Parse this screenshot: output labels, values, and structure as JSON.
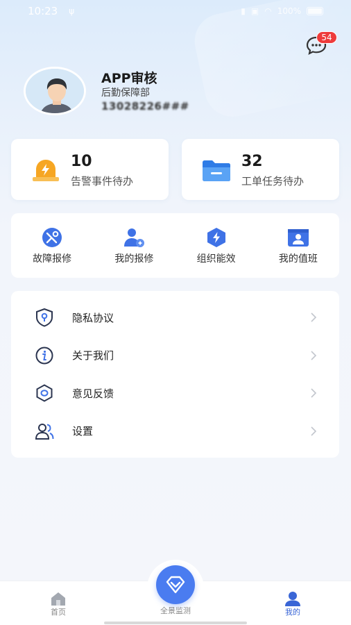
{
  "status_bar": {
    "time": "10:23",
    "usb_glyph": "ψ",
    "battery_text": "100%"
  },
  "header": {
    "message_badge": "54",
    "user": {
      "name": "APP审核",
      "department": "后勤保障部",
      "phone": "13028226###"
    }
  },
  "stats": [
    {
      "value": "10",
      "label": "告警事件待办",
      "icon": "alarm-light-icon",
      "color": "#f6a623"
    },
    {
      "value": "32",
      "label": "工单任务待办",
      "icon": "folder-icon",
      "color": "#3d8ef0"
    }
  ],
  "quick_actions": [
    {
      "label": "故障报修",
      "icon": "repair-tools-icon"
    },
    {
      "label": "我的报修",
      "icon": "user-wrench-icon"
    },
    {
      "label": "组织能效",
      "icon": "energy-hexagon-icon"
    },
    {
      "label": "我的值班",
      "icon": "duty-card-icon"
    }
  ],
  "menu": [
    {
      "label": "隐私协议",
      "icon": "shield-key-icon"
    },
    {
      "label": "关于我们",
      "icon": "info-icon"
    },
    {
      "label": "意见反馈",
      "icon": "feedback-hexagon-icon"
    },
    {
      "label": "设置",
      "icon": "users-settings-icon"
    }
  ],
  "tabbar": {
    "home": "首页",
    "panorama": "全景监测",
    "mine": "我的"
  },
  "colors": {
    "accent": "#4a7cf0",
    "badge": "#ee3b3b",
    "tab_active": "#3a66d6",
    "tab_inactive": "#9aa0a8"
  }
}
